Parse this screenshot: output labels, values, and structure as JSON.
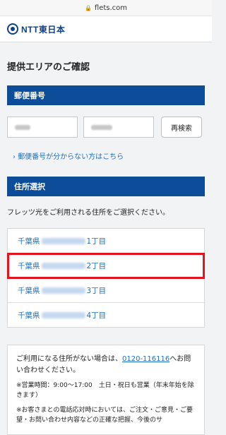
{
  "browser": {
    "url": "flets.com"
  },
  "header": {
    "logo_text": "NTT東日本"
  },
  "page": {
    "title": "提供エリアのご確認"
  },
  "postal": {
    "section_title": "郵便番号",
    "search_button": "再検索",
    "help_link": "郵便番号が分からない方はこちら"
  },
  "address": {
    "section_title": "住所選択",
    "intro": "フレッツ光をご利用される住所をご選択ください。",
    "items": [
      {
        "prefix": "千葉県",
        "suffix": "1丁目"
      },
      {
        "prefix": "千葉県",
        "suffix": "2丁目"
      },
      {
        "prefix": "千葉県",
        "suffix": "3丁目"
      },
      {
        "prefix": "千葉県",
        "suffix": "4丁目"
      }
    ]
  },
  "notice": {
    "text_before": "ご利用になる住所がない場合は、",
    "phone": "0120-116116",
    "text_after": "へお問い合わせください。",
    "hours": "※営業時間：9:00〜17:00　土日・祝日も営業（年末年始を除きます）",
    "note": "※お客さまとの電話応対時においては、ご注文・ご意見・ご要望・お問い合わせ内容などの正確な把握、今後のサ"
  },
  "colors": {
    "brand": "#0d4c99",
    "link": "#1e6fbf",
    "highlight": "#e4141e"
  }
}
